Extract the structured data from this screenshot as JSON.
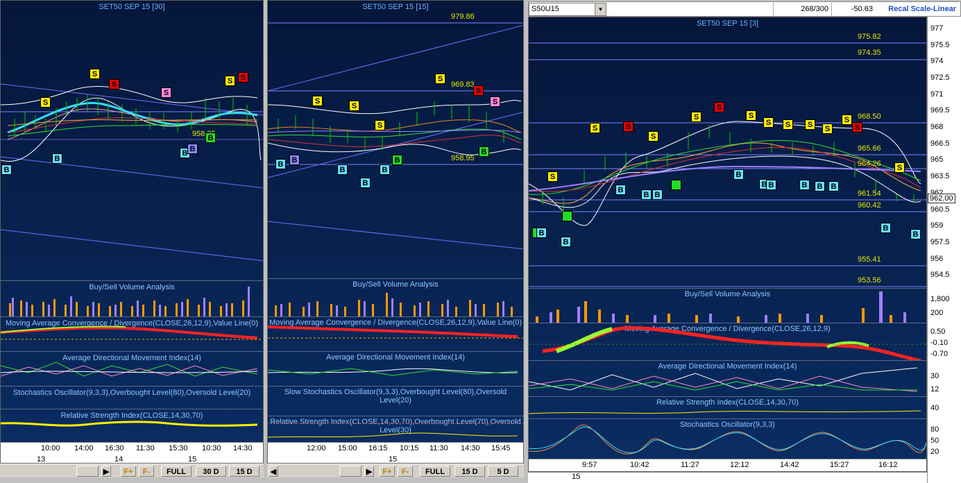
{
  "panel1": {
    "title": "SET50 SEP 15  [30]",
    "price_labels": [
      "958.35"
    ],
    "signals": {
      "s1": "S",
      "s2": "S",
      "s3": "S",
      "s4": "S",
      "s5": "S",
      "s6": "S",
      "b1": "B",
      "b2": "B",
      "b3": "B",
      "b4": "B",
      "b5": "B"
    },
    "volume_title": "Buy/Sell Volume Analysis",
    "macd_title": "Moving Average Convergence / Divergence(CLOSE,26,12,9),Value Line(0)",
    "adx_title": "Average Directional Movement Index(14)",
    "stoch_title": "Stochastics Oscillator(9,3,3),Overbought Level(80),Oversold Level(20)",
    "rsi_title": "Relative Strength Index(CLOSE,14,30,70)",
    "times": [
      "10:00",
      "14:00",
      "16:30",
      "11:30",
      "15:30",
      "10:30",
      "14:30"
    ],
    "dates": [
      "13",
      "14",
      "15"
    ],
    "toolbar": {
      "fplus": "F+",
      "fminus": "F-",
      "full": "FULL",
      "r30": "30 D",
      "r15": "15 D"
    }
  },
  "panel2": {
    "title": "SET50 SEP 15  [15]",
    "price_labels": [
      "979.86",
      "969.83",
      "958.95"
    ],
    "signals": {
      "s1": "S",
      "s2": "S",
      "s3": "S",
      "s4": "S",
      "s5": "S",
      "s6": "S",
      "b1": "B",
      "b2": "B",
      "b3": "B",
      "b4": "B",
      "b5": "B",
      "b6": "B",
      "b7": "B"
    },
    "volume_title": "Buy/Sell Volume Analysis",
    "macd_title": "Moving Average Convergence / Divergence(CLOSE,26,12,9),Value Line(0)",
    "adx_title": "Average Directional Movement Index(14)",
    "stoch_title": "Slow Stochastics Oscillator(9,3,3),Overbought Level(80),Oversold Level(20)",
    "rsi_title": "Relative Strength Index(CLOSE,14,30,70),Overbought Level(70),Oversold Level(30)",
    "times": [
      "12:00",
      "15:00",
      "16:15",
      "10:15",
      "11:30",
      "14:30",
      "15:45"
    ],
    "dates": [
      "15"
    ],
    "toolbar": {
      "fplus": "F+",
      "fminus": "F-",
      "full": "FULL",
      "r15": "15 D",
      "r5": "5 D"
    }
  },
  "panel3": {
    "symbol": "S50U15",
    "counter": "268/300",
    "change": "-50.63",
    "recalc": "Recal Scale-Linear",
    "title": "SET50 SEP 15  [3]",
    "price_labels": [
      "975.82",
      "974.35",
      "968.50",
      "965.66",
      "964.26",
      "961.54",
      "960.42",
      "955.41",
      "953.56"
    ],
    "last_price": "962.00",
    "y_ticks": [
      "977",
      "975.5",
      "974",
      "972.5",
      "971",
      "969.5",
      "968",
      "966.5",
      "965",
      "963.5",
      "962",
      "960.5",
      "959",
      "957.5",
      "956",
      "954.5"
    ],
    "vol_ticks": [
      "1,800",
      "200"
    ],
    "macd_ticks": [
      "0.50",
      "-0.10",
      "-0.70"
    ],
    "adx_ticks": [
      "30",
      "12"
    ],
    "rsi_ticks": [
      "40"
    ],
    "stoch_ticks": [
      "80",
      "50",
      "20"
    ],
    "volume_title": "Buy/Sell Volume Analysis",
    "macd_title": "Moving Average Convergence / Divergence(CLOSE,26,12,9)",
    "adx_title": "Average Directional Movement Index(14)",
    "rsi_title": "Relative Strength Index(CLOSE,14,30,70)",
    "stoch_title": "Stochastics Oscillator(9,3,3)",
    "times": [
      "9:57",
      "10:42",
      "11:27",
      "12:12",
      "14:42",
      "15:27",
      "16:12"
    ],
    "dates": [
      "15"
    ],
    "signals": {
      "s1": "S",
      "s2": "S",
      "s3": "S",
      "s4": "S",
      "s5": "S",
      "s6": "S",
      "s7": "S",
      "s8": "S",
      "s9": "S",
      "s10": "S",
      "s11": "S",
      "s12": "S",
      "s13": "S",
      "s14": "S",
      "b1": "B",
      "b2": "B",
      "b3": "B",
      "b4": "B",
      "b5": "B",
      "b6": "B",
      "b7": "B",
      "b8": "B",
      "b9": "B",
      "b10": "B",
      "b11": "B",
      "b12": "B",
      "b13": "B"
    }
  },
  "colors": {
    "background": "#06173a",
    "sell": "#ffee00",
    "buy": "#66e0ff",
    "strong_sell": "#e60000",
    "buy_green": "#22dd22",
    "axis_text": "#e6e600"
  }
}
